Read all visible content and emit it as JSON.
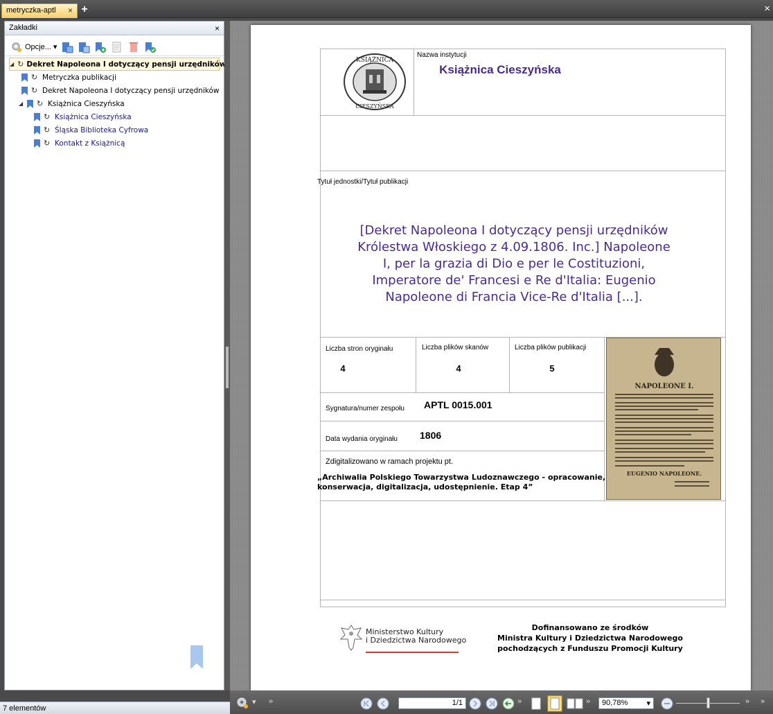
{
  "tab": {
    "title": "metryczka-aptl",
    "close": "×",
    "add": "+"
  },
  "window": {
    "close": "×"
  },
  "bookmarks_panel": {
    "title": "Zakładki",
    "close": "×",
    "options_label": "Opcje...",
    "items": [
      {
        "label": "Dekret Napoleona I dotyczący pensji urzędników",
        "level": 0,
        "expanded": true,
        "selected": true
      },
      {
        "label": "Metryczka publikacji",
        "level": 1
      },
      {
        "label": "Dekret Napoleona I dotyczący pensji urzędników",
        "level": 1
      },
      {
        "label": "Książnica Cieszyńska",
        "level": 0,
        "expanded": true
      },
      {
        "label": "Książnica Cieszyńska",
        "level": 1,
        "link": true
      },
      {
        "label": "Śląska Biblioteka Cyfrowa",
        "level": 1,
        "link": true
      },
      {
        "label": "Kontakt z Książnicą",
        "level": 1,
        "link": true
      }
    ]
  },
  "status": {
    "count": "7 elementów"
  },
  "document": {
    "logo_top": "KSIĄŻNICA",
    "logo_bottom": "CIESZYŃSKA",
    "institution_label": "Nazwa instytucji",
    "institution_name": "Książnica Cieszyńska",
    "title_label": "Tytuł jednostki/Tytuł publikacji",
    "title_lines": [
      "[Dekret Napoleona I dotyczący pensji urzędników",
      "Królestwa Włoskiego z 4.09.1806. Inc.] Napoleone",
      "I, per la grazia di Dio e per le Costituzioni,",
      "Imperatore de' Francesi e Re d'Italia: Eugenio",
      "Napoleone di Francia Vice-Re d'Italia [...]."
    ],
    "pages_label": "Liczba stron oryginału",
    "pages_value": "4",
    "scans_label": "Liczba plików skanów",
    "scans_value": "4",
    "files_label": "Liczba plików publikacji",
    "files_value": "5",
    "signature_label": "Sygnatura/numer zespołu",
    "signature_value": "APTL 0015.001",
    "date_label": "Data wydania oryginału",
    "date_value": "1806",
    "project_label": "Zdigitalizowano w ramach projektu pt.",
    "project_lines": [
      "„Archiwalia Polskiego Towarzystwa Ludoznawczego - opracowanie,",
      "konserwacja, digitalizacja, udostępnienie. Etap 4”"
    ],
    "thumbnail_heading": "NAPOLEONE I.",
    "thumbnail_signature": "EUGENIO NAPOLEONE.",
    "ministry_lines": [
      "Ministerstwo Kultury",
      "i Dziedzictwa Narodowego"
    ],
    "funding_lines": [
      "Dofinansowano ze środków",
      "Ministra Kultury i Dziedzictwa Narodowego",
      "pochodzących z Funduszu Promocji Kultury"
    ]
  },
  "navigation": {
    "page": "1/1",
    "zoom": "90,78%"
  },
  "colors": {
    "accent": "#4b2a8c",
    "tab": "#f7cf6d",
    "bookmark": "#4a7fd0"
  }
}
